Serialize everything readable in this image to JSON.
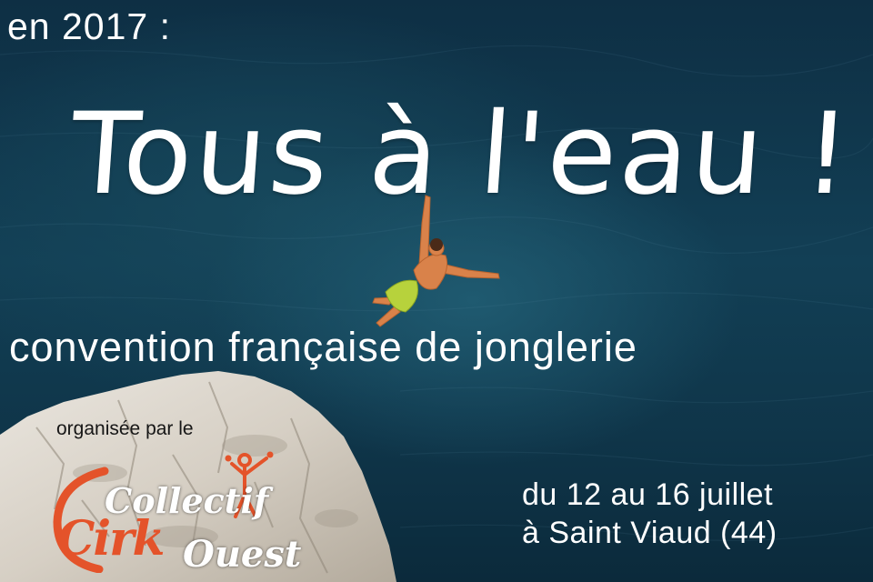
{
  "poster": {
    "year_line": "en 2017 :",
    "title": "Tous à l'eau !",
    "subtitle": "convention française de jonglerie",
    "organiser_label": "organisée par le",
    "logo": {
      "line1": "Collectif",
      "line2_part1": "Cirk",
      "line2_part2": "Ouest"
    },
    "dates_line": "du 12 au 16 juillet",
    "location_line": "à Saint Viaud (44)"
  },
  "colors": {
    "sea_dark": "#0e2f44",
    "sea_light": "#1f5a70",
    "text": "#ffffff",
    "logo_orange": "#e4532a",
    "rock": "#d9d3c8"
  },
  "icons": [
    "diver-figure",
    "cliff-rock",
    "juggler-logo-icon"
  ]
}
